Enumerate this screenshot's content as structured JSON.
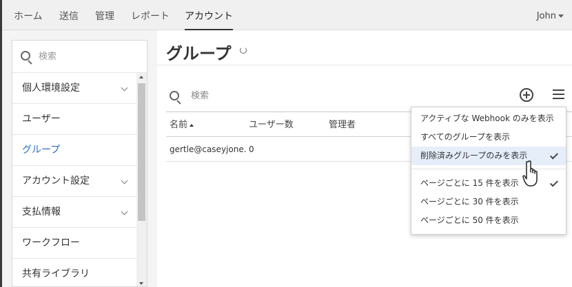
{
  "nav": {
    "tabs": [
      {
        "label": "ホーム"
      },
      {
        "label": "送信"
      },
      {
        "label": "管理"
      },
      {
        "label": "レポート"
      },
      {
        "label": "アカウント"
      }
    ],
    "active_tab": "アカウント",
    "user_label": "John"
  },
  "sidebar": {
    "search_placeholder": "検索",
    "items": [
      {
        "label": "個人環境設定",
        "expandable": true
      },
      {
        "label": "ユーザー",
        "expandable": false
      },
      {
        "label": "グループ",
        "expandable": false,
        "active": true
      },
      {
        "label": "アカウント設定",
        "expandable": true
      },
      {
        "label": "支払情報",
        "expandable": true
      },
      {
        "label": "ワークフロー",
        "expandable": false
      },
      {
        "label": "共有ライブラリ",
        "expandable": false
      }
    ]
  },
  "main": {
    "title": "グループ",
    "search_placeholder": "検索",
    "columns": [
      "名前",
      "ユーザー数",
      "管理者"
    ],
    "rows": [
      {
        "name": "gertle@caseyjone...",
        "users": "0",
        "admin": ""
      }
    ]
  },
  "dropdown": {
    "items": [
      {
        "label": "アクティブな Webhook のみを表示",
        "checked": false
      },
      {
        "label": "すべてのグループを表示",
        "checked": false
      },
      {
        "label": "削除済みグループのみを表示",
        "checked": true,
        "hovered": true
      },
      {
        "label": "ページごとに 15 件を表示",
        "checked": true
      },
      {
        "label": "ページごとに 30 件を表示",
        "checked": false
      },
      {
        "label": "ページごとに 50 件を表示",
        "checked": false
      }
    ]
  },
  "colors": {
    "accent_link": "#2b6cc4",
    "hover_bg": "#e6eefa"
  }
}
